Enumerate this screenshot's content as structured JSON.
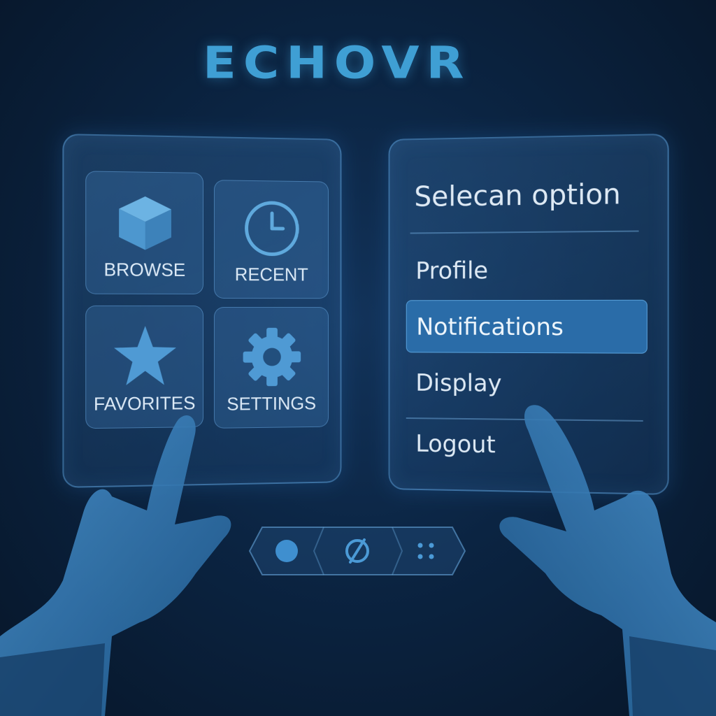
{
  "brand": {
    "logo_text": "ECHOVR",
    "accent_color": "#3f9fd4"
  },
  "left_panel": {
    "tiles": [
      {
        "label": "BROWSE",
        "icon": "cube-icon"
      },
      {
        "label": "RECENT",
        "icon": "clock-icon"
      },
      {
        "label": "FAVORITES",
        "icon": "star-icon"
      },
      {
        "label": "SETTINGS",
        "icon": "gear-icon"
      }
    ]
  },
  "right_panel": {
    "title": "Selecan option",
    "items": [
      {
        "label": "Profile",
        "selected": false
      },
      {
        "label": "Notifications",
        "selected": true
      },
      {
        "label": "Display",
        "selected": false
      },
      {
        "label": "Logout",
        "selected": false
      }
    ],
    "highlight_color": "#2a6ca8"
  },
  "dock": {
    "buttons": [
      {
        "icon": "circle-icon"
      },
      {
        "icon": "disabled-slash-icon"
      },
      {
        "icon": "dots-grid-icon"
      }
    ]
  }
}
